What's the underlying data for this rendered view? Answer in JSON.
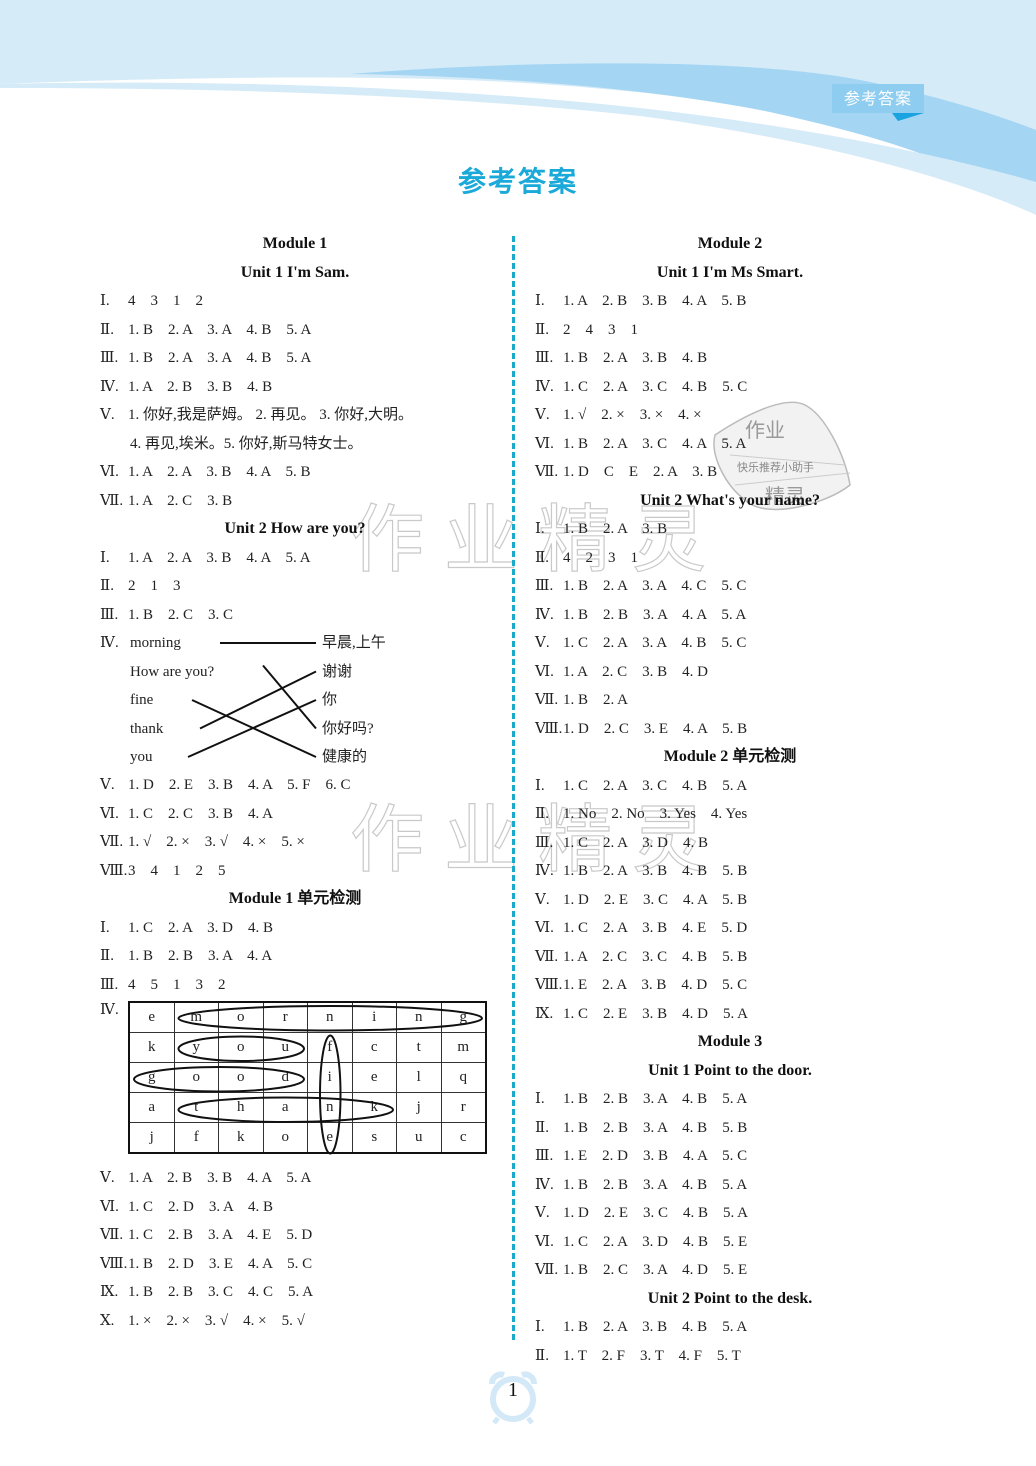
{
  "header": {
    "tab_label": "参考答案",
    "page_title": "参考答案"
  },
  "watermark": {
    "text_1": "作业精灵",
    "text_2": "作业精灵",
    "stamp_top": "作业",
    "stamp_mid": "快乐推荐小助手",
    "stamp_bottom": "精灵"
  },
  "left_column": {
    "m1_title": "Module  1",
    "u1_title": "Unit  1    I'm  Sam.",
    "u1": [
      {
        "n": "Ⅰ.",
        "t": "4    3    1    2"
      },
      {
        "n": "Ⅱ.",
        "t": "1. B    2. A    3. A    4. B    5. A"
      },
      {
        "n": "Ⅲ.",
        "t": "1. B    2. A    3. A    4. B    5. A"
      },
      {
        "n": "Ⅳ.",
        "t": "1. A    2. B    3. B    4. B"
      },
      {
        "n": "Ⅴ.",
        "t": "1. 你好,我是萨姆。 2. 再见。 3. 你好,大明。"
      }
    ],
    "u1_v_cont": "4. 再见,埃米。5. 你好,斯马特女士。",
    "u1_b": [
      {
        "n": "Ⅵ.",
        "t": "1. A    2. A    3. B    4. A    5. B"
      },
      {
        "n": "Ⅶ.",
        "t": "1. A    2. C    3. B"
      }
    ],
    "u2_title": "Unit  2    How  are  you?",
    "u2": [
      {
        "n": "Ⅰ.",
        "t": "1. A    2. A    3. B    4. A    5. A"
      },
      {
        "n": "Ⅱ.",
        "t": "2    1    3"
      },
      {
        "n": "Ⅲ.",
        "t": "1. B    2. C    3. C"
      }
    ],
    "matching": {
      "num": "Ⅳ.",
      "left": [
        "morning",
        "How  are  you?",
        "fine",
        "thank",
        "you"
      ],
      "right": [
        "早晨,上午",
        "谢谢",
        "你",
        "你好吗?",
        "健康的"
      ],
      "pairs": [
        [
          0,
          0
        ],
        [
          1,
          3
        ],
        [
          2,
          4
        ],
        [
          3,
          1
        ],
        [
          4,
          2
        ]
      ]
    },
    "u2_b": [
      {
        "n": "Ⅴ.",
        "t": "1. D    2. E    3. B    4. A    5. F    6. C"
      },
      {
        "n": "Ⅵ.",
        "t": "1. C    2. C    3. B    4. A"
      },
      {
        "n": "Ⅶ.",
        "t": "1. √    2. ×    3. √    4. ×    5. ×"
      },
      {
        "n": "Ⅷ.",
        "t": "3    4    1    2    5"
      }
    ],
    "m1_test_title": "Module  1    单元检测",
    "m1_test": [
      {
        "n": "Ⅰ.",
        "t": "1. C    2. A    3. D    4. B"
      },
      {
        "n": "Ⅱ.",
        "t": "1. B    2. B    3. A    4. A"
      },
      {
        "n": "Ⅲ.",
        "t": "4    5    1    3    2"
      }
    ],
    "word_grid": {
      "num": "Ⅳ.",
      "rows": [
        [
          "e",
          "m",
          "o",
          "r",
          "n",
          "i",
          "n",
          "g"
        ],
        [
          "k",
          "y",
          "o",
          "u",
          "f",
          "c",
          "t",
          "m"
        ],
        [
          "g",
          "o",
          "o",
          "d",
          "i",
          "e",
          "l",
          "q"
        ],
        [
          "a",
          "t",
          "h",
          "a",
          "n",
          "k",
          "j",
          "r"
        ],
        [
          "j",
          "f",
          "k",
          "o",
          "e",
          "s",
          "u",
          "c"
        ]
      ],
      "circled_words": [
        {
          "word": "morning",
          "row": 0,
          "from": 1,
          "to": 7,
          "dir": "h"
        },
        {
          "word": "you",
          "row": 1,
          "from": 1,
          "to": 3,
          "dir": "h"
        },
        {
          "word": "good",
          "row": 2,
          "from": 0,
          "to": 3,
          "dir": "h"
        },
        {
          "word": "thank",
          "row": 3,
          "from": 1,
          "to": 5,
          "dir": "h"
        },
        {
          "word": "fine",
          "col": 4,
          "from": 1,
          "to": 4,
          "dir": "v"
        }
      ]
    },
    "m1_test_b": [
      {
        "n": "Ⅴ.",
        "t": "1. A    2. B    3. B    4. A    5. A"
      },
      {
        "n": "Ⅵ.",
        "t": "1. C    2. D    3. A    4. B"
      },
      {
        "n": "Ⅶ.",
        "t": "1. C    2. B    3. A    4. E    5. D"
      },
      {
        "n": "Ⅷ.",
        "t": "1. B    2. D    3. E    4. A    5. C"
      },
      {
        "n": "Ⅸ.",
        "t": "1. B    2. B    3. C    4. C    5. A"
      },
      {
        "n": "Ⅹ.",
        "t": "1. ×    2. ×    3. √    4. ×    5. √"
      }
    ]
  },
  "right_column": {
    "m2_title": "Module  2",
    "u1_title": "Unit  1    I'm  Ms  Smart.",
    "u1": [
      {
        "n": "Ⅰ.",
        "t": "1. A    2. B    3. B    4. A    5. B"
      },
      {
        "n": "Ⅱ.",
        "t": "2    4    3    1"
      },
      {
        "n": "Ⅲ.",
        "t": "1. B    2. A    3. B    4. B"
      },
      {
        "n": "Ⅳ.",
        "t": "1. C    2. A    3. C    4. B    5. C"
      },
      {
        "n": "Ⅴ.",
        "t": "1. √    2. ×    3. ×    4. ×"
      },
      {
        "n": "Ⅵ.",
        "t": "1. B    2. A    3. C    4. A    5. A"
      },
      {
        "n": "Ⅶ.",
        "t": "1. D    C    E    2. A    3. B"
      }
    ],
    "u2_title": "Unit  2    What's  your  name?",
    "u2": [
      {
        "n": "Ⅰ.",
        "t": "1. B    2. A    3. B"
      },
      {
        "n": "Ⅱ.",
        "t": "4    2    3    1"
      },
      {
        "n": "Ⅲ.",
        "t": "1. B    2. A    3. A    4. C    5. C"
      },
      {
        "n": "Ⅳ.",
        "t": "1. B    2. B    3. A    4. A    5. A"
      },
      {
        "n": "Ⅴ.",
        "t": "1. C    2. A    3. A    4. B    5. C"
      },
      {
        "n": "Ⅵ.",
        "t": "1. A    2. C    3. B    4. D"
      },
      {
        "n": "Ⅶ.",
        "t": "1. B    2. A"
      },
      {
        "n": "Ⅷ.",
        "t": "1. D    2. C    3. E    4. A    5. B"
      }
    ],
    "m2_test_title": "Module  2    单元检测",
    "m2_test": [
      {
        "n": "Ⅰ.",
        "t": "1. C    2. A    3. C    4. B    5. A"
      },
      {
        "n": "Ⅱ.",
        "t": "1. No    2. No    3. Yes    4. Yes"
      },
      {
        "n": "Ⅲ.",
        "t": "1. C    2. A    3. D    4. B"
      },
      {
        "n": "Ⅳ.",
        "t": "1. B    2. A    3. B    4. B    5. B"
      },
      {
        "n": "Ⅴ.",
        "t": "1. D    2. E    3. C    4. A    5. B"
      },
      {
        "n": "Ⅵ.",
        "t": "1. C    2. A    3. B    4. E    5. D"
      },
      {
        "n": "Ⅶ.",
        "t": "1. A    2. C    3. C    4. B    5. B"
      },
      {
        "n": "Ⅷ.",
        "t": "1. E    2. A    3. B    4. D    5. C"
      },
      {
        "n": "Ⅸ.",
        "t": "1. C    2. E    3. B    4. D    5. A"
      }
    ],
    "m3_title": "Module  3",
    "m3u1_title": "Unit  1    Point  to  the  door.",
    "m3u1": [
      {
        "n": "Ⅰ.",
        "t": "1. B    2. B    3. A    4. B    5. A"
      },
      {
        "n": "Ⅱ.",
        "t": "1. B    2. B    3. A    4. B    5. B"
      },
      {
        "n": "Ⅲ.",
        "t": "1. E    2. D    3. B    4. A    5. C"
      },
      {
        "n": "Ⅳ.",
        "t": "1. B    2. B    3. A    4. B    5. A"
      },
      {
        "n": "Ⅴ.",
        "t": "1. D    2. E    3. C    4. B    5. A"
      },
      {
        "n": "Ⅵ.",
        "t": "1. C    2. A    3. D    4. B    5. E"
      },
      {
        "n": "Ⅶ.",
        "t": "1. B    2. C    3. A    4. D    5. E"
      }
    ],
    "m3u2_title": "Unit  2    Point  to  the  desk.",
    "m3u2": [
      {
        "n": "Ⅰ.",
        "t": "1. B    2. A    3. B    4. B    5. A"
      },
      {
        "n": "Ⅱ.",
        "t": "1. T    2. F    3. T    4. F    5. T"
      }
    ]
  },
  "footer": {
    "page_number": "1"
  },
  "colors": {
    "accent": "#1aa9d8",
    "header_light": "#d6ebf8",
    "header_mid": "#a4d6f3",
    "tab_bg": "#8fcdf0",
    "tab_flag": "#1aa3e0",
    "divider": "#1aa9c8",
    "clock": "#d4e9f7"
  }
}
